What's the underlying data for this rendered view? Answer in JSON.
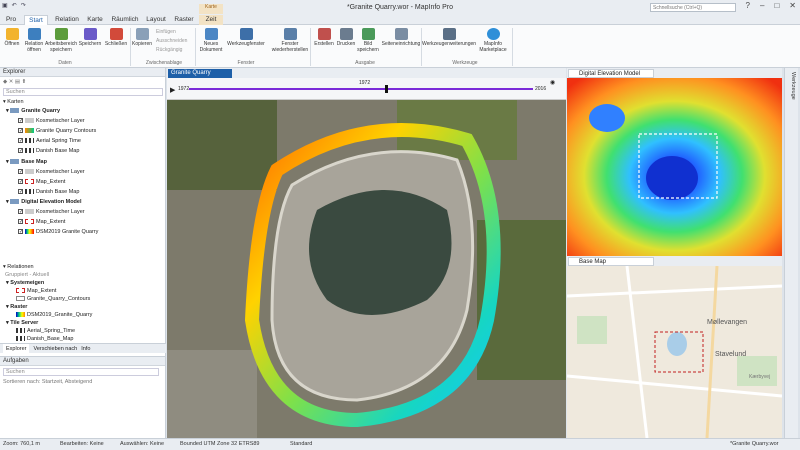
{
  "window": {
    "title": "*Granite Quarry.wor - MapInfo Pro",
    "search_placeholder": "Schnellsuche (Ctrl+Q)",
    "context_group": "Karte"
  },
  "tabs": [
    "Pro",
    "Start",
    "Relation",
    "Karte",
    "Räumlich",
    "Layout",
    "Raster",
    "Zeit"
  ],
  "ribbon": {
    "daten": [
      "Öffnen",
      "Relation öffnen",
      "Arbeitsbereich speichern",
      "Speichern",
      "Schließen"
    ],
    "daten_label": "Daten",
    "clip": {
      "kopieren": "Kopieren",
      "einfuegen": "Einfügen",
      "ausschneiden": "Ausschneiden",
      "rueckgaengig": "Rückgängig"
    },
    "clip_label": "Zwischenablage",
    "fenster": [
      "Neues Dokument",
      "Werkzeugfenster",
      "Fenster wiederherstellen"
    ],
    "fenster_label": "Fenster",
    "ausgabe": [
      "Erstellen",
      "Drucken",
      "Bild speichern",
      "Seiteneinrichtung"
    ],
    "ausgabe_label": "Ausgabe",
    "werkzeuge": [
      "Werkzeugerweiterungen",
      "MapInfo Marketplace"
    ],
    "werkzeuge_label": "Werkzeuge"
  },
  "explorer": {
    "title": "Explorer",
    "search": "Suchen",
    "karten": "Karten",
    "maps": [
      {
        "name": "Granite Quarry",
        "layers": [
          "Kosmetischer Layer",
          "Granite Quarry Contours",
          "Aerial Spring Time",
          "Danish Base Map"
        ]
      },
      {
        "name": "Base Map",
        "layers": [
          "Kosmetischer Layer",
          "Map_Extent",
          "Danish Base Map"
        ]
      },
      {
        "name": "Digital Elevation Model",
        "layers": [
          "Kosmetischer Layer",
          "Map_Extent",
          "DSM2019 Granite Quarry"
        ]
      }
    ],
    "relationen": "Relationen",
    "group_filter": "Gruppiert - Aktuell",
    "rel_groups": [
      {
        "name": "Systemeigen",
        "items": [
          "Map_Extent",
          "Granite_Quarry_Contours"
        ]
      },
      {
        "name": "Raster",
        "items": [
          "DSM2019_Granite_Quarry"
        ]
      },
      {
        "name": "Tile Server",
        "items": [
          "Aerial_Spring_Time",
          "Danish_Base_Map"
        ]
      }
    ],
    "bottom_tabs": [
      "Explorer",
      "Verschieben nach",
      "Info"
    ]
  },
  "aufgaben": {
    "title": "Aufgaben",
    "search": "Suchen",
    "sort": "Sortieren nach: Startzeit, Absteigend"
  },
  "map": {
    "tab": "Granite Quarry",
    "time_start": "1972",
    "time_mid": "1972",
    "time_end": "2016"
  },
  "dem": {
    "tab": "Digital Elevation Model"
  },
  "base": {
    "tab": "Base Map",
    "labels": [
      "Møllevangen",
      "Stavelund",
      "Kærbyvej"
    ]
  },
  "side_tab": "Werkzeuge",
  "status": {
    "zoom": "Zoom: 760,1 m",
    "edit": "Bearbeiten: Keine",
    "select": "Auswählen: Keine",
    "proj": "Bounded UTM Zone 32 ETRS89",
    "std": "Standard",
    "file": "*Granite Quarry.wor"
  },
  "colors": {
    "accent": "#1d5fa8",
    "timeline": "#7b2ad8"
  }
}
